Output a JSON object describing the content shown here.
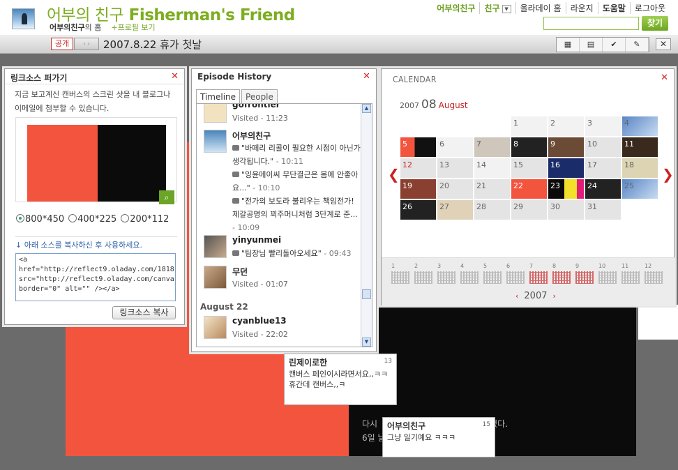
{
  "header": {
    "title_kr": "어부의 친구",
    "title_en": "Fisherman's Friend",
    "home_name": "어부의친구",
    "home_suffix": "의 홈",
    "profile_link": "+프로필 보기",
    "nav": [
      "어부의친구",
      "친구",
      "올라데이 홈",
      "라운지",
      "도움말",
      "로그아웃"
    ],
    "search_placeholder": "",
    "search_button": "찾기"
  },
  "toolbar": {
    "visibility": "공개",
    "switch": "‹ ›",
    "episode_title": "2007.8.22 휴가 첫날",
    "tools": [
      "▦",
      "▤",
      "✔",
      "✎"
    ],
    "close": "✕"
  },
  "link_panel": {
    "title": "링크소스 퍼가기",
    "description": "지금 보고계신 캔버스의 스크린 샷을 내 블로그나 이메일에 첨부할 수 있습니다.",
    "sizes": [
      "800*450",
      "400*225",
      "200*112"
    ],
    "selected_size": "800*450",
    "hint": "↓ 아래 소스를 복사하신 후 사용하세요.",
    "code": "<a\nhref=\"http://reflect9.oladay.com/1818\nsrc=\"http://reflect9.oladay.com/canva\nborder=\"0\" alt=\"\" /></a>",
    "copy_button": "링크소스 복사"
  },
  "episode_panel": {
    "title": "Episode History",
    "tabs": [
      "Timeline",
      "People"
    ],
    "active_tab": "Timeline",
    "items": [
      {
        "name": "gofrontier",
        "visited": "Visited - 11:23"
      },
      {
        "name": "어부의친구",
        "comments": [
          {
            "text": "\"바떼리 리콜이 필요한 시점이 아닌가 생각됩니다.\"",
            "time": "- 10:11"
          },
          {
            "text": "\"잉윤메이씨 무단결근은 몸에 안좋아요...\"",
            "time": "- 10:10"
          },
          {
            "text": "\"전가의 보도라 불리우는 책임전가! 제갈공명의 꾀주머니처럼 3단계로 준...",
            "time": "- 10:09"
          }
        ]
      },
      {
        "name": "yinyunmei",
        "comments": [
          {
            "text": "\"팀장님 빨리돌아오세요\"",
            "time": "- 09:43"
          }
        ]
      },
      {
        "name": "무던",
        "visited": "Visited - 01:07"
      },
      {
        "name": "cyanblue13",
        "visited": "Visited - 22:02"
      }
    ],
    "day_label": "August 22"
  },
  "calendar": {
    "title": "CALENDAR",
    "year": "2007",
    "month_num": "08",
    "month_name": "August",
    "days": [
      "1",
      "2",
      "3",
      "4",
      "5",
      "6",
      "7",
      "8",
      "9",
      "10",
      "11",
      "12",
      "13",
      "14",
      "15",
      "16",
      "17",
      "18",
      "19",
      "20",
      "21",
      "22",
      "23",
      "24",
      "25",
      "26",
      "27",
      "28",
      "29",
      "30",
      "31"
    ],
    "months": [
      "1",
      "2",
      "3",
      "4",
      "5",
      "6",
      "7",
      "8",
      "9",
      "10",
      "11",
      "12"
    ],
    "nav_year": "2007",
    "prev": "‹",
    "next": "›"
  },
  "bubbles": [
    {
      "name": "린제이로한",
      "count": "13",
      "text": "캔버스 페인이시라면서요,,ㅋㅋ 휴간데 캔버스,,ㅋ"
    },
    {
      "name": "어부의친구",
      "count": "15",
      "text": "그냥 일기예요 ㅋㅋㅋ"
    }
  ],
  "canvas_text": [
    "다시",
    "6일 날",
    "이었다."
  ],
  "colors": {
    "accent": "#7dad20",
    "red": "#f3543e",
    "close": "#dd2222"
  }
}
